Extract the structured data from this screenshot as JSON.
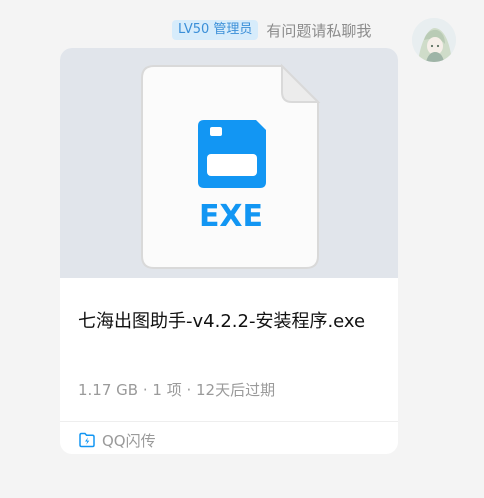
{
  "sender": {
    "level_badge": "LV50 管理员",
    "name": "有问题请私聊我"
  },
  "file_card": {
    "extension_label": "EXE",
    "file_name": "七海出图助手-v4.2.2-安装程序.exe",
    "meta": "1.17 GB · 1 项 · 12天后过期",
    "source_label": "QQ闪传"
  },
  "icons": {
    "avatar": "anime-avatar",
    "file": "exe-file-icon",
    "source": "flash-transfer-icon"
  },
  "colors": {
    "accent": "#1296f3",
    "badge_bg": "#d7ecfb",
    "badge_text": "#3b8fd8"
  }
}
